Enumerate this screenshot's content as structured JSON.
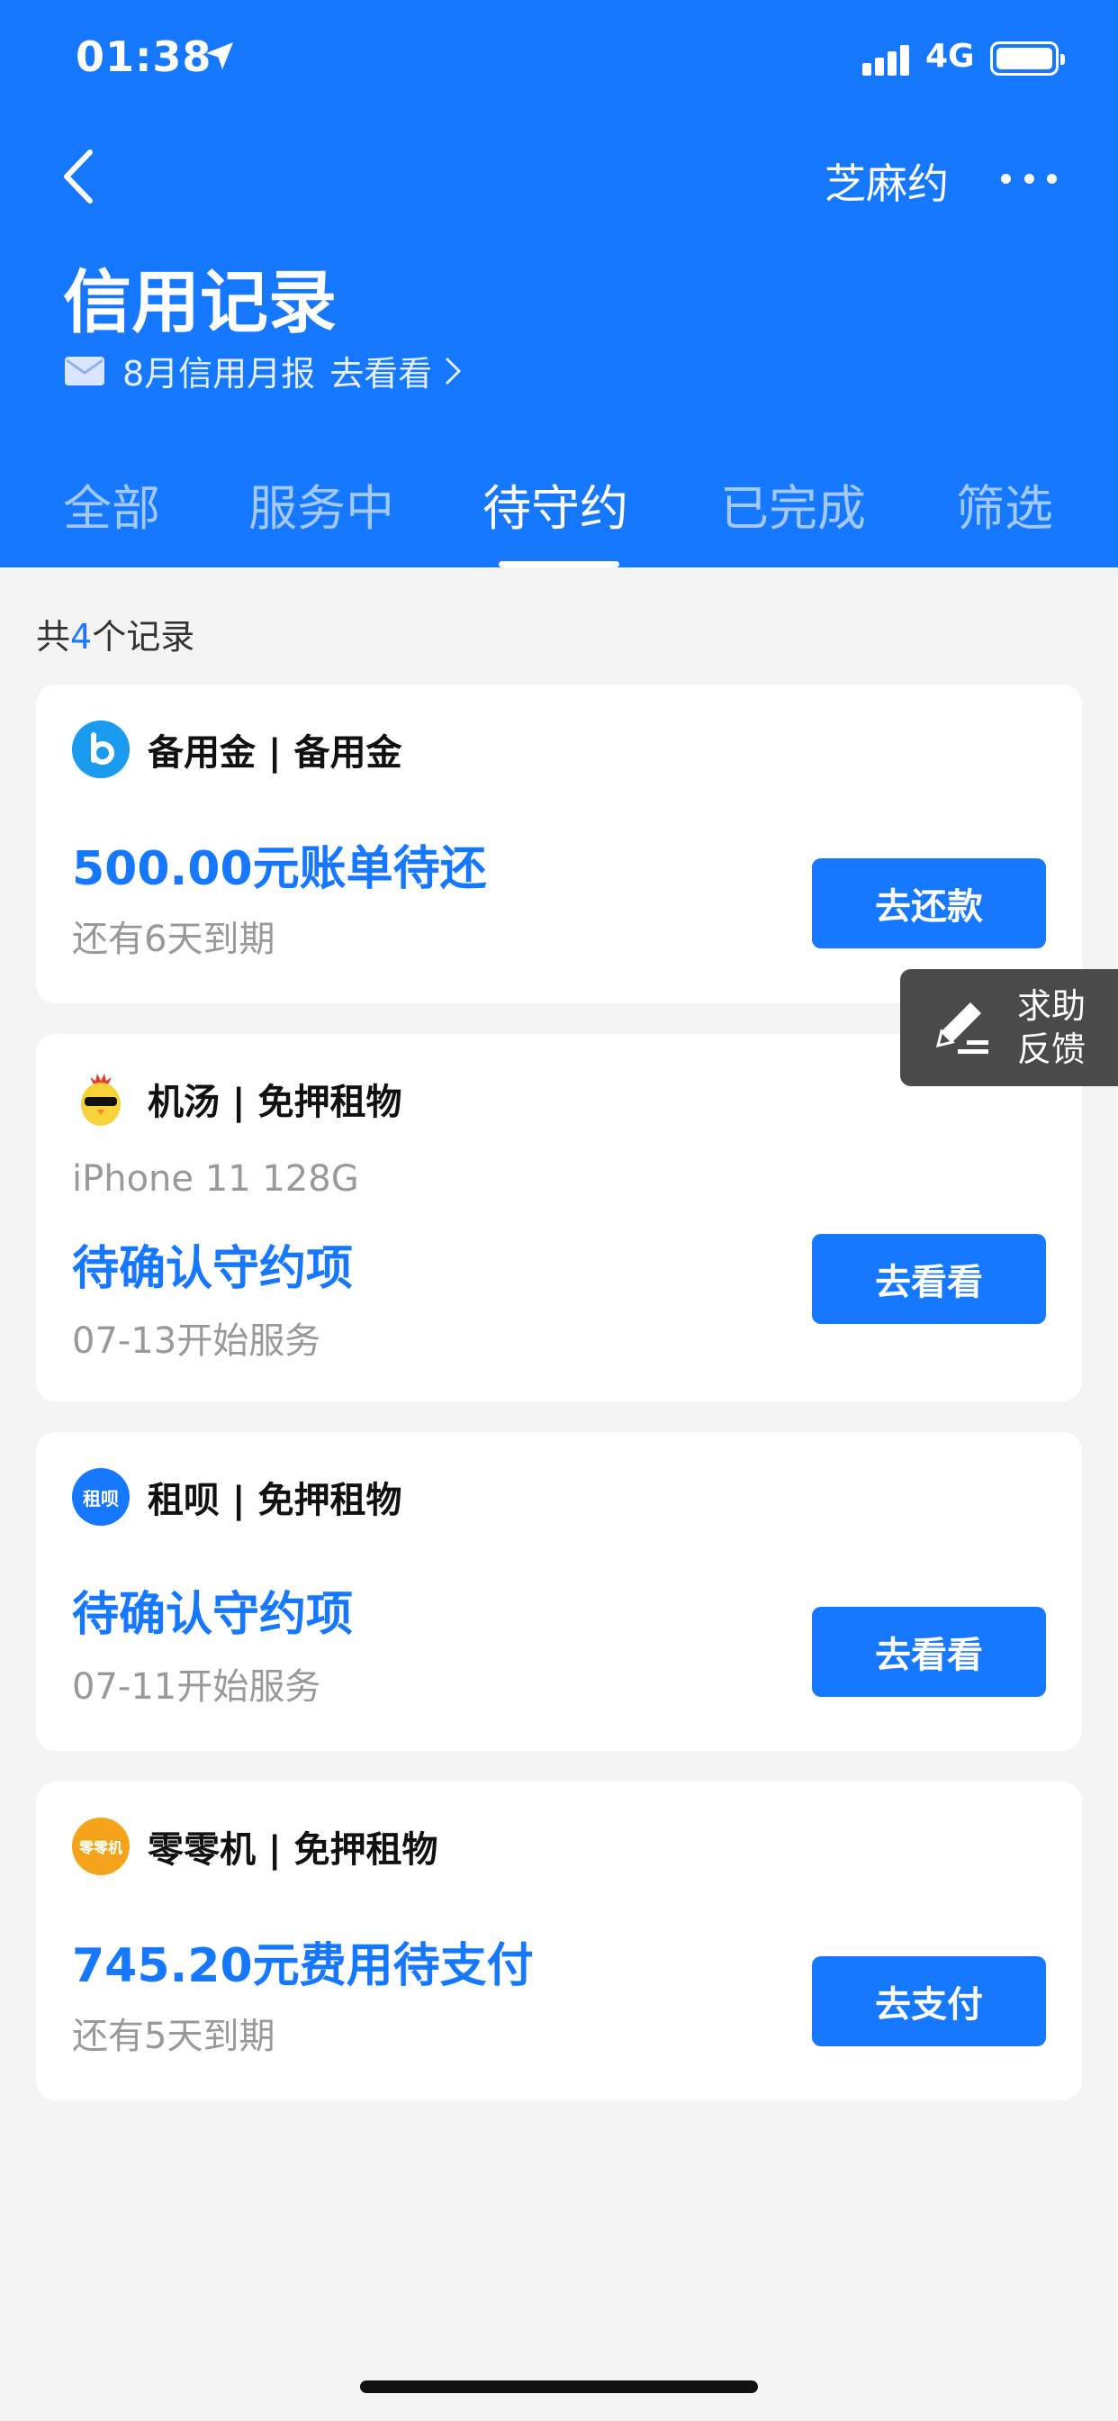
{
  "status_bar": {
    "time": "01:38",
    "network": "4G"
  },
  "nav": {
    "right_label": "芝麻约"
  },
  "header": {
    "title": "信用记录",
    "report_text": "8月信用月报",
    "report_link": "去看看"
  },
  "tabs": [
    {
      "label": "全部"
    },
    {
      "label": "服务中"
    },
    {
      "label": "待守约"
    },
    {
      "label": "已完成"
    },
    {
      "label": "筛选"
    }
  ],
  "active_tab": "待守约",
  "count": {
    "prefix": "共",
    "number": "4",
    "suffix": "个记录"
  },
  "records": [
    {
      "merchant": "备用金 | 备用金",
      "logo_text": "b",
      "status": "500.00元账单待还",
      "hint": "还有6天到期",
      "action": "去还款"
    },
    {
      "merchant": "机汤 | 免押租物",
      "logo_text": "",
      "item": "iPhone 11 128G",
      "status": "待确认守约项",
      "hint": "07-13开始服务",
      "action": "去看看"
    },
    {
      "merchant": "租呗 | 免押租物",
      "logo_text": "租呗",
      "status": "待确认守约项",
      "hint": "07-11开始服务",
      "action": "去看看"
    },
    {
      "merchant": "零零机 | 免押租物",
      "logo_text": "零零机",
      "status": "745.20元费用待支付",
      "hint": "还有5天到期",
      "action": "去支付"
    }
  ],
  "help": {
    "line1": "求助",
    "line2": "反馈"
  },
  "colors": {
    "primary": "#1677ff",
    "background": "#f4f4f4",
    "help_bg": "#4a4a4a"
  }
}
